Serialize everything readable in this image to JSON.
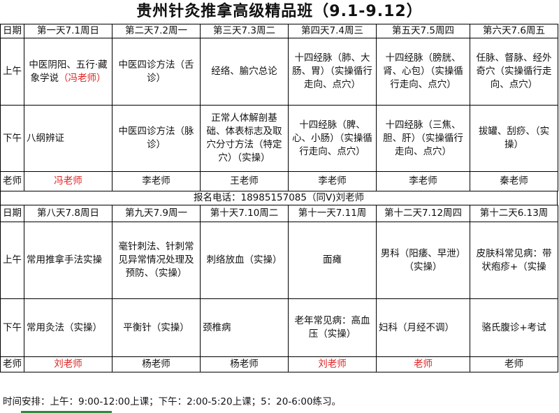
{
  "title": "贵州针灸推拿高级精品班（9.1-9.12）",
  "labels": {
    "date": "日期",
    "am": "上午",
    "pm": "下午",
    "teacher": "老师"
  },
  "week1": {
    "days": [
      "第一天7.1周日",
      "第二天7.2周一",
      "第三天7.3周二",
      "第四天7.4周三",
      "第五天7.5周四",
      "第六天7.6周五"
    ],
    "am": [
      "中医阴阳、五行·藏象学说",
      "中医四诊方法（舌诊）",
      "经络、腧穴总论",
      "十四经脉（肺、大肠、胃）（实操循行走向、点穴）",
      "十四经脉（膀胱、肾、心包）（实操循行走向、点穴）",
      "任脉、督脉、经外奇穴（实操循行走向、点穴）"
    ],
    "am_note": "（冯老师）",
    "pm": [
      "八纲辨证",
      "中医四诊方法（脉诊）",
      "正常人体解剖基础、体表标志及取穴分寸方法（特定穴）（实操）",
      "十四经脉（脾、心、小肠）（实操循行走向、点穴）",
      "十四经脉（三焦、胆、肝）（实操循行走向、点穴）",
      "拔罐、刮痧、（实操）"
    ],
    "teachers": [
      "冯老师",
      "李老师",
      "王老师",
      "李老师",
      "李老师",
      "秦老师"
    ]
  },
  "phone": "报名电话：18985157085（同V)刘老师",
  "week2": {
    "days": [
      "第八天7.8周日",
      "第九天7.9周一",
      "第十天7.10周二",
      "第十一天7.11周",
      "第十二天7.12周四",
      "第十二天6.13周"
    ],
    "am": [
      "常用推拿手法实操",
      "毫针刺法、针刺常见异常情况处理及预防、（实操）",
      "刺络放血（实操）",
      "面瘫",
      "男科（阳痿、早泄）（实操）",
      "皮肤科常见病：带状疱疹+（实操"
    ],
    "pm": [
      "常用灸法（实操）",
      "平衡针（实操）",
      "颈椎病",
      "老年常见病：高血压（实操）",
      "妇科（月经不调）",
      "骆氏腹诊+考试"
    ],
    "teachers": [
      "刘老师",
      "杨老师",
      "杨老师",
      "刘老师",
      "老师",
      "老师"
    ]
  },
  "schedule": "时间安排：上午：9:00-12:00上课；下午：2:00-5:20上课；5：20-6:00练习。"
}
